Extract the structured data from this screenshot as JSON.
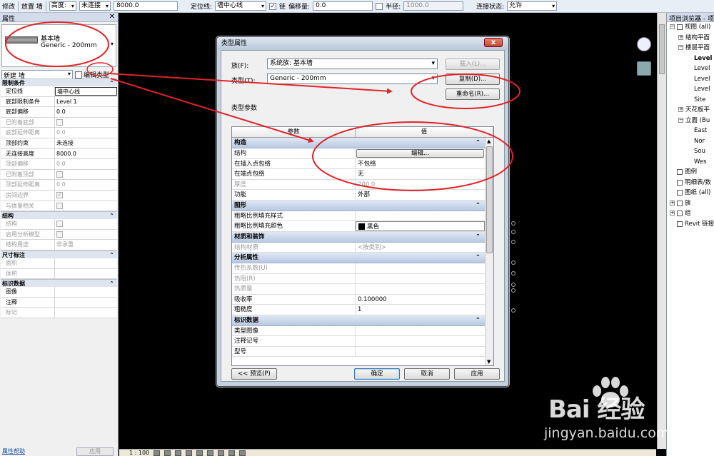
{
  "option_bar": {
    "left_labels": [
      "修改",
      "放置 墙"
    ],
    "height_label": "高度:",
    "unconnected_value": "未连接",
    "height_value": "8000.0",
    "location_line_label": "定位线:",
    "location_line_value": "墙中心线",
    "chain_label": "链",
    "offset_label": "偏移量:",
    "offset_value": "0.0",
    "radius_label": "半径:",
    "radius_value": "1000.0",
    "join_status_label": "连接状态:",
    "join_status_value": "允许"
  },
  "properties": {
    "title": "属性",
    "type_family": "基本墙",
    "type_name": "Generic - 200mm",
    "instance_selector": "新建 墙",
    "edit_type_label": "编辑类型",
    "sections": [
      {
        "name": "限制条件",
        "rows": [
          {
            "k": "定位线",
            "v": "墙中心线",
            "dis": false,
            "box": true
          },
          {
            "k": "底部限制条件",
            "v": "Level 1",
            "dis": false
          },
          {
            "k": "底部偏移",
            "v": "0.0",
            "dis": false
          },
          {
            "k": "已附着底部",
            "v": "",
            "dis": true,
            "cb": true
          },
          {
            "k": "底部延伸距离",
            "v": "0.0",
            "dis": true
          },
          {
            "k": "顶部约束",
            "v": "未连接",
            "dis": false
          },
          {
            "k": "无连接高度",
            "v": "8000.0",
            "dis": false
          },
          {
            "k": "顶部偏移",
            "v": "0.0",
            "dis": true
          },
          {
            "k": "已附着顶部",
            "v": "",
            "dis": true,
            "cb": true
          },
          {
            "k": "顶部延伸距离",
            "v": "0.0",
            "dis": true
          },
          {
            "k": "房间边界",
            "v": "",
            "dis": true,
            "cb": true,
            "checked": true
          },
          {
            "k": "与体量相关",
            "v": "",
            "dis": true,
            "cb": true
          }
        ]
      },
      {
        "name": "结构",
        "rows": [
          {
            "k": "结构",
            "v": "",
            "dis": true,
            "cb": true
          },
          {
            "k": "启用分析模型",
            "v": "",
            "dis": true,
            "cb": true
          },
          {
            "k": "结构用途",
            "v": "非承重",
            "dis": true
          }
        ]
      },
      {
        "name": "尺寸标注",
        "rows": [
          {
            "k": "面积",
            "v": "",
            "dis": true
          },
          {
            "k": "体积",
            "v": "",
            "dis": true
          }
        ]
      },
      {
        "name": "标识数据",
        "rows": [
          {
            "k": "图像",
            "v": "",
            "dis": false
          },
          {
            "k": "注释",
            "v": "",
            "dis": false
          },
          {
            "k": "标记",
            "v": "",
            "dis": true
          }
        ]
      }
    ],
    "help_link": "属性帮助",
    "apply_label": "应用"
  },
  "status_bar": {
    "scale": "1 : 100"
  },
  "project_browser": {
    "title": "项目浏览器 - 项目",
    "nodes": [
      {
        "label": "视图 (all)",
        "depth": 0,
        "pm": "-",
        "bold": false,
        "icon": true
      },
      {
        "label": "结构平面",
        "depth": 1,
        "pm": "+",
        "bold": false
      },
      {
        "label": "楼层平面",
        "depth": 1,
        "pm": "-",
        "bold": false
      },
      {
        "label": "Level",
        "depth": 2,
        "pm": "",
        "bold": true
      },
      {
        "label": "Level",
        "depth": 2,
        "pm": "",
        "bold": false
      },
      {
        "label": "Level",
        "depth": 2,
        "pm": "",
        "bold": false
      },
      {
        "label": "Level",
        "depth": 2,
        "pm": "",
        "bold": false
      },
      {
        "label": "Site",
        "depth": 2,
        "pm": "",
        "bold": false
      },
      {
        "label": "天花板平",
        "depth": 1,
        "pm": "+",
        "bold": false
      },
      {
        "label": "立面 (Bu",
        "depth": 1,
        "pm": "-",
        "bold": false
      },
      {
        "label": "East",
        "depth": 2,
        "pm": "",
        "bold": false
      },
      {
        "label": "Nor",
        "depth": 2,
        "pm": "",
        "bold": false
      },
      {
        "label": "Sou",
        "depth": 2,
        "pm": "",
        "bold": false
      },
      {
        "label": "Wes",
        "depth": 2,
        "pm": "",
        "bold": false
      },
      {
        "label": "图例",
        "depth": 0,
        "pm": "",
        "bold": false,
        "icon": true
      },
      {
        "label": "明细表/数",
        "depth": 0,
        "pm": "",
        "bold": false,
        "icon": true
      },
      {
        "label": "图纸 (all)",
        "depth": 0,
        "pm": "",
        "bold": false,
        "icon": true
      },
      {
        "label": "族",
        "depth": 0,
        "pm": "+",
        "bold": false,
        "icon": true
      },
      {
        "label": "组",
        "depth": 0,
        "pm": "+",
        "bold": false,
        "icon": true
      },
      {
        "label": "Revit 链接",
        "depth": 0,
        "pm": "",
        "bold": false,
        "icon": true
      }
    ]
  },
  "dialog": {
    "title": "类型属性",
    "close_label": "x",
    "family_label": "族(F):",
    "family_value": "系统族: 基本墙",
    "type_label": "类型(T):",
    "type_value": "Generic - 200mm",
    "load_button": "载入(L)...",
    "duplicate_button": "复制(D)...",
    "rename_button": "重命名(R)...",
    "type_params_label": "类型参数",
    "col_param": "参数",
    "col_value": "值",
    "sections": [
      {
        "name": "构造",
        "rows": [
          {
            "k": "结构",
            "v": "编辑...",
            "btn": true
          },
          {
            "k": "在插入点包络",
            "v": "不包络"
          },
          {
            "k": "在端点包络",
            "v": "无"
          },
          {
            "k": "厚度",
            "v": "200.0",
            "dis": true
          },
          {
            "k": "功能",
            "v": "外部"
          }
        ]
      },
      {
        "name": "图形",
        "rows": [
          {
            "k": "粗略比例填充样式",
            "v": ""
          },
          {
            "k": "粗略比例填充颜色",
            "v": "黑色",
            "swatch": true
          }
        ]
      },
      {
        "name": "材质和装饰",
        "rows": [
          {
            "k": "结构材质",
            "v": "<按类别>",
            "dis": true
          }
        ]
      },
      {
        "name": "分析属性",
        "rows": [
          {
            "k": "传热系数(U)",
            "v": "",
            "dis": true
          },
          {
            "k": "热阻(R)",
            "v": "",
            "dis": true
          },
          {
            "k": "热质量",
            "v": "",
            "dis": true
          },
          {
            "k": "吸收率",
            "v": "0.100000"
          },
          {
            "k": "粗糙度",
            "v": "1"
          }
        ]
      },
      {
        "name": "标识数据",
        "rows": [
          {
            "k": "类型图像",
            "v": ""
          },
          {
            "k": "注释记号",
            "v": ""
          },
          {
            "k": "型号",
            "v": ""
          }
        ]
      }
    ],
    "preview_button": "<< 预览(P)",
    "ok_button": "确定",
    "cancel_button": "取消",
    "apply_button": "应用"
  },
  "watermark": {
    "brand": "Bai 经验",
    "url": "jingyan.baidu.com"
  },
  "colors": {
    "annotation": "#e0232b",
    "canvas": "#000000",
    "section_header": "#c4d3ea"
  }
}
